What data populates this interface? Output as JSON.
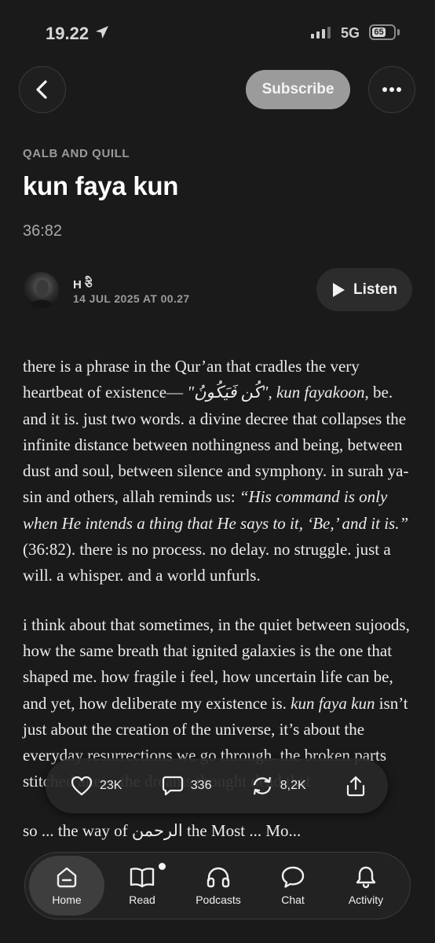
{
  "status_bar": {
    "time": "19.22",
    "network": "5G",
    "battery": "65",
    "battery_level": 0.65
  },
  "header": {
    "subscribe_label": "Subscribe"
  },
  "post": {
    "publication": "QALB AND QUILL",
    "title": "kun faya kun",
    "subtitle": "36:82",
    "author": "H ཅི",
    "date": "14 JUL 2025 AT 00.27",
    "listen_label": "Listen"
  },
  "article": {
    "p1": {
      "a": "there is a phrase in the Qur’an that cradles the very heartbeat of existence— ",
      "b": "\"كُن فَيَكُونُ\", kun fayakoon",
      "c": ", be. and it is. just two words. a divine decree that collapses the infinite distance between nothingness and being, between dust and soul, between silence and symphony. in surah ya-sin and others, allah reminds us: ",
      "d": "“His command is only when He intends a thing that He says to it, ‘Be,’ and it is.”",
      "e": " (36:82). there is no process. no delay. no struggle. just a will. a whisper. and a world unfurls."
    },
    "p2": {
      "a": "i think about that sometimes, in the quiet between sujoods, how the same breath that ignited galaxies is the one that shaped me. how fragile i feel, how uncertain life can be, and yet, how deliberate my existence is. ",
      "b": "kun faya kun",
      "c": " isn’t just about the creation of the universe, it’s about the everyday resurrections we go through. the broken parts stitched anew. the dreams thought dead that"
    },
    "p3": "so ... the way of الرحمن the Most ... Mo..."
  },
  "reactions": {
    "likes": "23K",
    "comments": "336",
    "restacks": "8,2K"
  },
  "tabs": [
    {
      "label": "Home",
      "icon": "home-icon",
      "active": true
    },
    {
      "label": "Read",
      "icon": "book-icon",
      "badge": true
    },
    {
      "label": "Podcasts",
      "icon": "headphones-icon"
    },
    {
      "label": "Chat",
      "icon": "chat-bubble-icon"
    },
    {
      "label": "Activity",
      "icon": "bell-icon"
    }
  ]
}
